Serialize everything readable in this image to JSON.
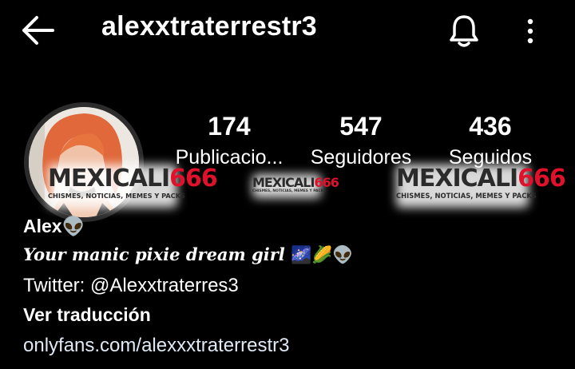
{
  "header": {
    "username": "alexxtraterrestr3",
    "back_icon": "arrow-left-icon",
    "notification_icon": "bell-icon",
    "more_icon": "more-vertical-icon"
  },
  "stats": [
    {
      "value": "174",
      "label": "Publicacio..."
    },
    {
      "value": "547",
      "label": "Seguidores"
    },
    {
      "value": "436",
      "label": "Seguidos"
    }
  ],
  "watermark": {
    "brand_part1": "MEXICALI",
    "brand_part2": "666",
    "tagline": "CHISMES, NOTICIAS, MEMES Y PACKS"
  },
  "bio": {
    "name": "Alex",
    "name_emoji": "👽",
    "tagline": "Your manic pixie dream girl",
    "tagline_emojis": "🌌🌽👽",
    "twitter": "Twitter: @Alexxtraterres3",
    "translate_label": "Ver traducción",
    "link": "onlyfans.com/alexxxtraterrestr3"
  },
  "colors": {
    "background": "#000000",
    "text": "#ffffff",
    "watermark_red": "#e0112b"
  }
}
